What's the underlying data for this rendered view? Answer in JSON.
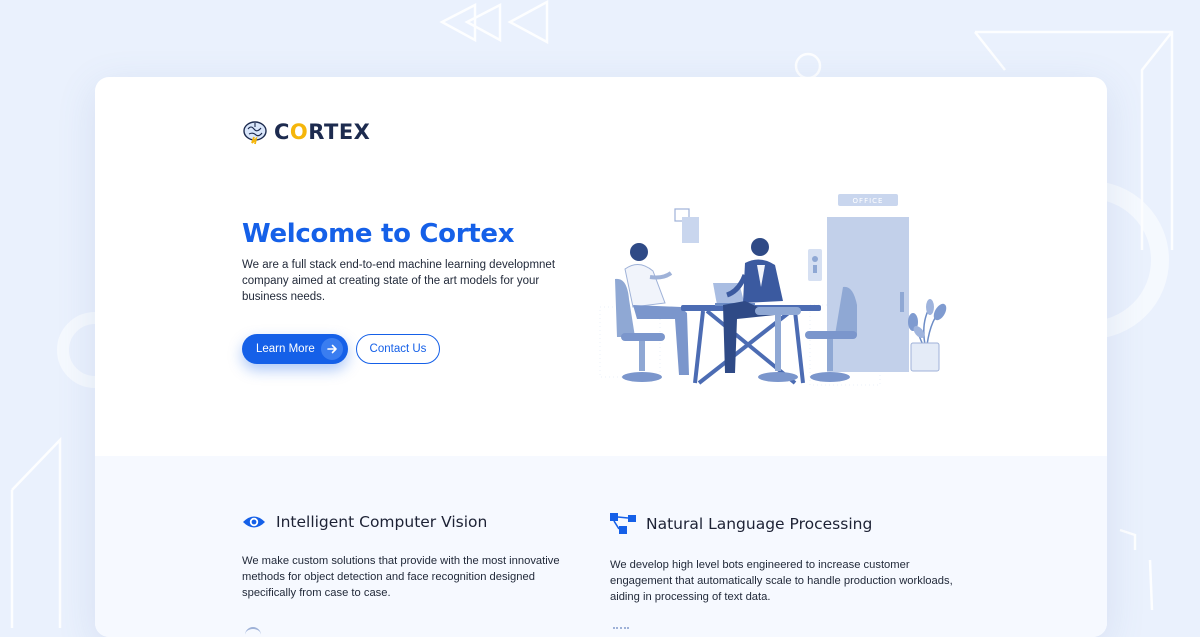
{
  "brand": {
    "name_pre": "C",
    "name_o": "O",
    "name_post": "RTEX"
  },
  "hero": {
    "title": "Welcome to Cortex",
    "description": "We are a full stack end-to-end machine learning developmnet company aimed at creating state of the art models for your business needs.",
    "primary_button": "Learn More",
    "secondary_button": "Contact Us"
  },
  "illustration": {
    "door_sign": "OFFICE"
  },
  "features": [
    {
      "icon": "eye-icon",
      "title": "Intelligent Computer Vision",
      "description": "We make custom solutions that provide with the most innovative methods for object detection and face recognition designed specifically from case to case."
    },
    {
      "icon": "flowchart-icon",
      "title": "Natural Language Processing",
      "description": "We develop high level bots engineered to increase customer engagement that automatically scale to handle production workloads, aiding in processing of text data."
    }
  ],
  "colors": {
    "accent": "#1560e8",
    "logo_accent": "#f5b60b",
    "page_background": "#eaf1fd",
    "illustration": "#8fa8d4"
  }
}
